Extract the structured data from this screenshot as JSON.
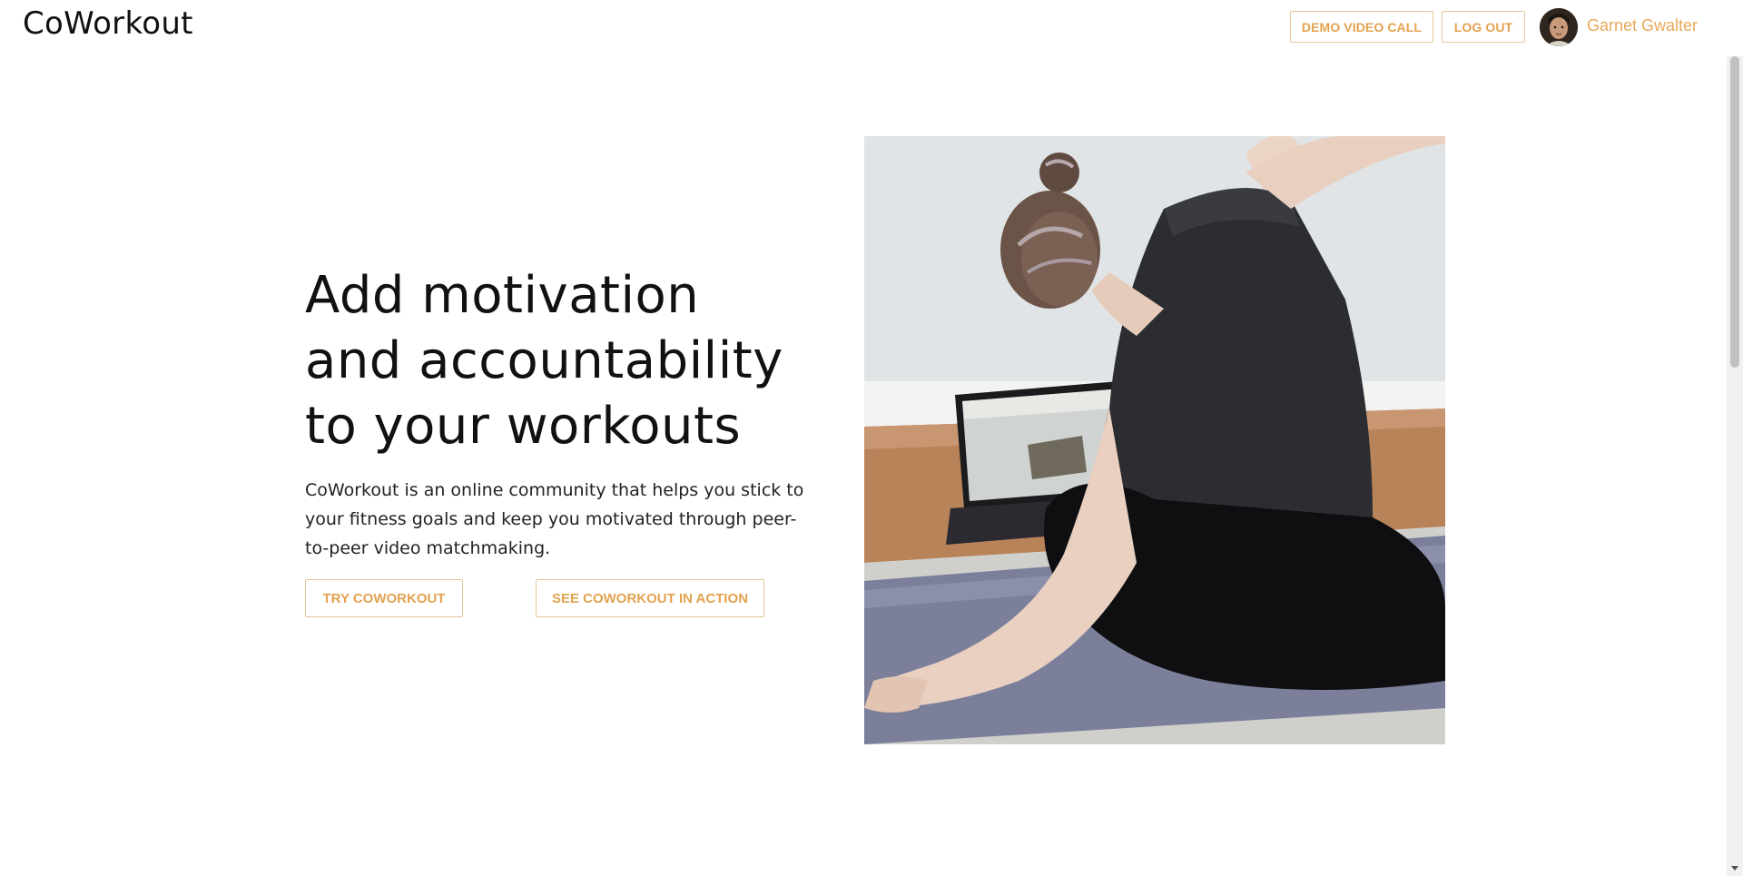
{
  "header": {
    "brand": "CoWorkout",
    "demo_button": "DEMO VIDEO CALL",
    "logout_button": "LOG OUT",
    "user_name": "Garnet Gwalter"
  },
  "hero": {
    "title_lines": [
      "Add motivation",
      "and accountability",
      "to your workouts"
    ],
    "description_lines": [
      "CoWorkout is an online community that helps you stick to",
      "your fitness goals and keep you motivated through peer-",
      "to-peer video matchmaking."
    ],
    "primary_cta": "TRY COWORKOUT",
    "secondary_cta": "SEE COWORKOUT IN ACTION"
  },
  "colors": {
    "accent": "#e3a24f",
    "accent_border": "#e6c698",
    "text": "#111111"
  }
}
